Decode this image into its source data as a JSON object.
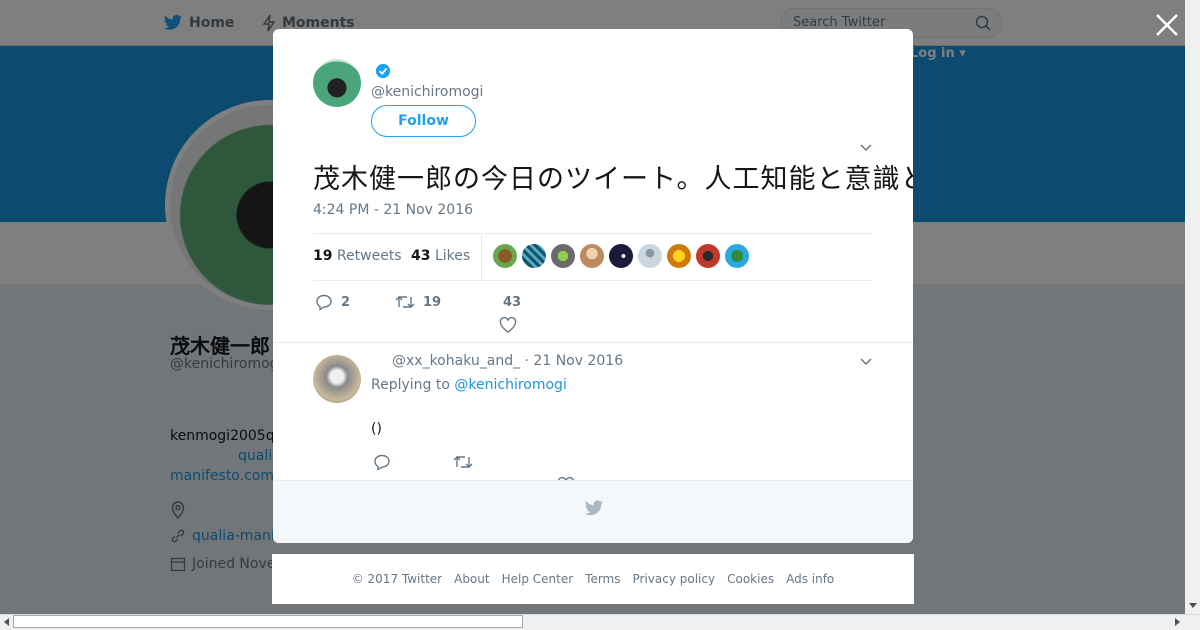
{
  "nav": {
    "home_label": "Home",
    "moments_label": "Moments",
    "search_placeholder": "Search Twitter",
    "login_label": "Log in ▾"
  },
  "profile": {
    "name": "茂木健一郎",
    "handle": "@kenichiromogi",
    "bio": "kenmogi2005q",
    "link1": "quali",
    "link2": "manifesto.com",
    "url": "qualia-mani",
    "joined": "Joined Nove"
  },
  "modal": {
    "handle": "@kenichiromogi",
    "follow_label": "Follow",
    "tweet_text": "茂木健一郎の今日のツイート。人工知能と意識とクオリアについて考えていることを、少しだけ書いてみました。読んでください。",
    "timestamp": "4:24 PM - 21 Nov 2016",
    "retweets_count": "19",
    "retweets_label": "Retweets",
    "likes_count": "43",
    "likes_label": "Likes",
    "reply_count": "2",
    "retweet_count": "19",
    "like_count": "43"
  },
  "reply": {
    "meta": "@xx_kohaku_and_ · 21 Nov 2016",
    "replying_prefix": "Replying to",
    "replying_handle": "@kenichiromogi",
    "text": "()"
  },
  "footer": {
    "items": [
      "© 2017 Twitter",
      "About",
      "Help Center",
      "Terms",
      "Privacy policy",
      "Cookies",
      "Ads info"
    ]
  },
  "colors": {
    "accent": "#1da1f2",
    "banner": "#1b95e0",
    "muted": "#657786"
  }
}
